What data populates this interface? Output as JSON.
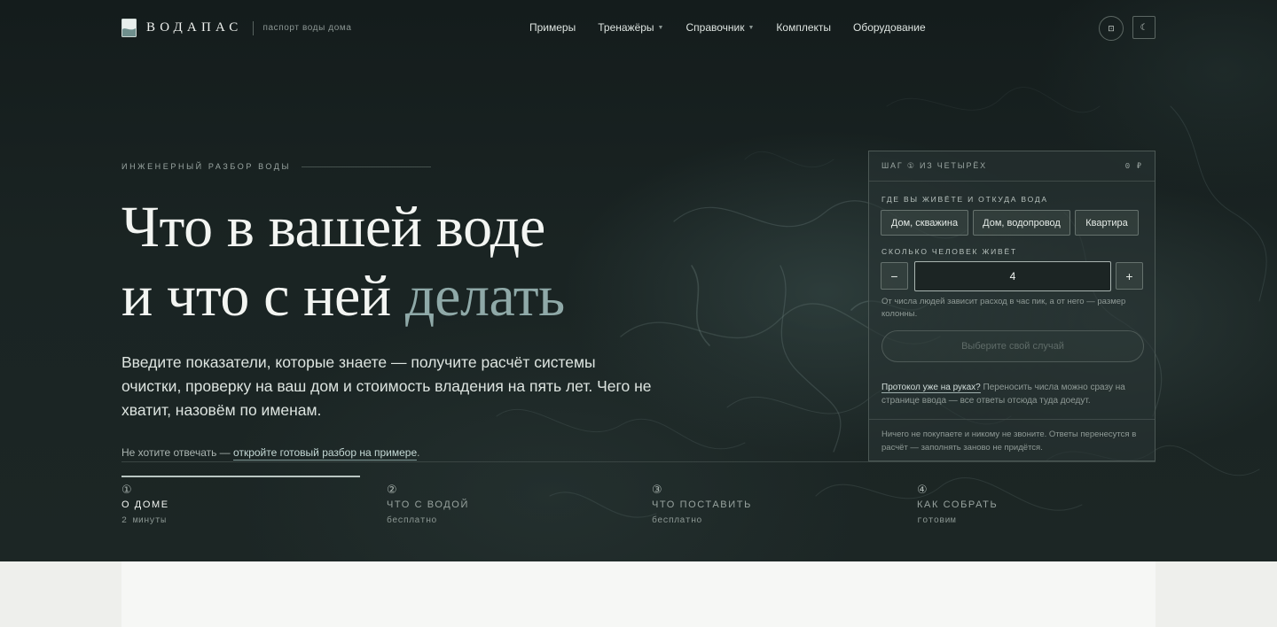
{
  "header": {
    "brand": "ВОДАПАС",
    "tagline": "паспорт воды дома",
    "nav": [
      {
        "label": "Примеры",
        "has_dropdown": false
      },
      {
        "label": "Тренажёры",
        "has_dropdown": true
      },
      {
        "label": "Справочник",
        "has_dropdown": true
      },
      {
        "label": "Комплекты",
        "has_dropdown": false
      },
      {
        "label": "Оборудование",
        "has_dropdown": false
      }
    ],
    "round_button_glyph": "⊡",
    "square_button_glyph": "☾"
  },
  "hero": {
    "eyebrow": "ИНЖЕНЕРНЫЙ РАЗБОР ВОДЫ",
    "headline_line1": "Что в вашей воде",
    "headline_line2_start": "и что с ней ",
    "headline_accent": "делать",
    "lead": "Введите показатели, которые знаете — получите расчёт системы очистки, проверку на ваш дом и стоимость владения на пять лет. Чего не хватит, назовём по именам.",
    "hint_prefix": "Не хотите отвечать — ",
    "hint_link": "откройте готовый разбор на примере",
    "hint_suffix": "."
  },
  "steps": [
    {
      "num": "①",
      "title": "О ДОМЕ",
      "sub": "2 минуты",
      "active": true
    },
    {
      "num": "②",
      "title": "ЧТО С ВОДОЙ",
      "sub": "бесплатно",
      "active": false
    },
    {
      "num": "③",
      "title": "ЧТО ПОСТАВИТЬ",
      "sub": "бесплатно",
      "active": false
    },
    {
      "num": "④",
      "title": "КАК СОБРАТЬ",
      "sub": "готовим",
      "active": false
    }
  ],
  "form": {
    "step_label": "ШАГ ① ИЗ ЧЕТЫРЁХ",
    "price": "0 ₽",
    "home_label": "ГДЕ ВЫ ЖИВЁТЕ И ОТКУДА ВОДА",
    "home_options": [
      "Дом, скважина",
      "Дом, водопровод",
      "Квартира"
    ],
    "people_label": "СКОЛЬКО ЧЕЛОВЕК ЖИВЁТ",
    "minus": "−",
    "plus": "+",
    "people_value": "4",
    "people_help": "От числа людей зависит расход в час пик, а от него — размер колонны.",
    "submit_label": "Выберите свой случай",
    "protocol_link": "Протокол уже на руках?",
    "protocol_text": " Переносить числа можно сразу на странице ввода — все ответы отсюда туда доедут.",
    "note": "Ничего не покупаете и никому не звоните. Ответы перенесутся в расчёт — заполнять заново не придётся."
  },
  "colors": {
    "hero_bg": "#1a2423",
    "accent": "#8fa9a8",
    "page_bg": "#eeefec"
  }
}
